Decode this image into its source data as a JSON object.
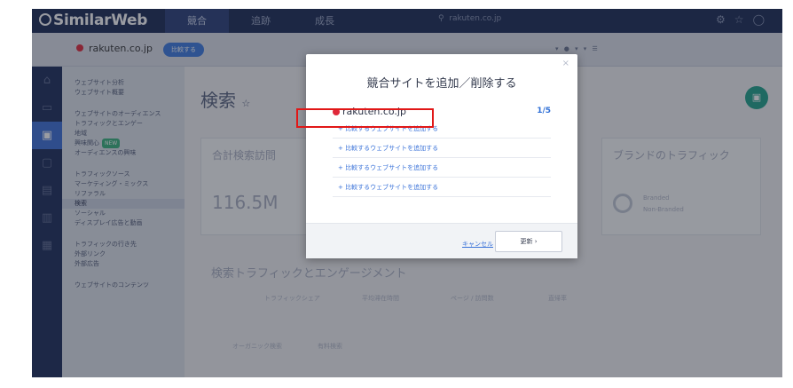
{
  "app": {
    "logo": "SimilarWeb"
  },
  "topnav": {
    "tabs": [
      "競合",
      "追跡",
      "成長"
    ],
    "search": "rakuten.co.jp"
  },
  "subbar": {
    "site": "rakuten.co.jp",
    "compare": "比較する"
  },
  "sidebar": {
    "groups": [
      {
        "items": [
          "ウェブサイト分析",
          "ウェブサイト概要"
        ]
      },
      {
        "items": [
          "ウェブサイトのオーディエンス",
          "トラフィックとエンゲー",
          "地域",
          "興味関心",
          "オーディエンスの興味"
        ]
      },
      {
        "items": [
          "トラフィックソース",
          "マーケティング・ミックス",
          "リファラル",
          "検索",
          "ソーシャル",
          "ディスプレイ広告と動画"
        ]
      },
      {
        "items": [
          "トラフィックの行き先",
          "外部リンク",
          "外部広告"
        ]
      },
      {
        "items": [
          "ウェブサイトのコンテンツ"
        ]
      }
    ],
    "new_badge": "NEW"
  },
  "main": {
    "title": "検索",
    "total_search": "合計検索訪問",
    "big_number": "116.5M",
    "brand_traffic": "ブランドのトラフィック",
    "branded": "Branded",
    "non_branded": "Non-Branded",
    "search_engagement": "検索トラフィックとエンゲージメント",
    "tabs": [
      "トラフィックシェア",
      "平均滞在時間",
      "ページ / 訪問数",
      "直帰率"
    ],
    "organic": "オーガニック検索",
    "paid": "有料検索"
  },
  "modal": {
    "title": "競合サイトを追加／削除する",
    "site": "rakuten.co.jp",
    "count": "1/5",
    "add_label": "+ 比較するウェブサイトを追加する",
    "cancel": "キャンセル",
    "update": "更新 ›",
    "close": "×"
  }
}
